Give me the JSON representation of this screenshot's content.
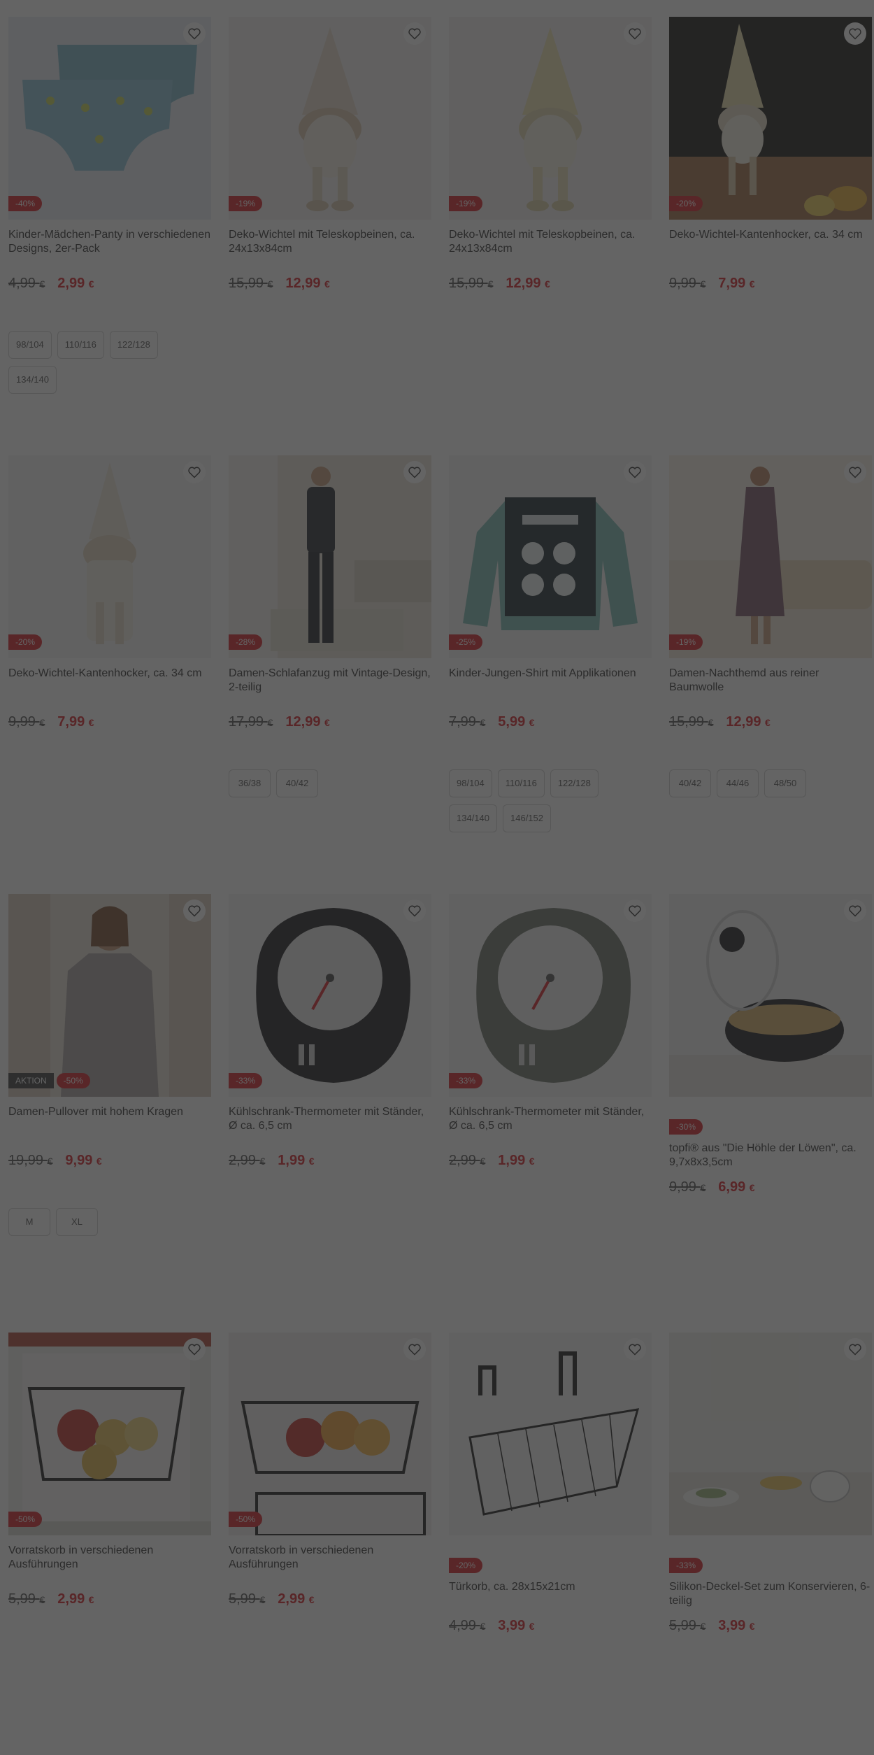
{
  "colors": {
    "sale": "#d8222a",
    "action": "#3d3d3d",
    "overlay": "rgba(40,40,40,0.72)"
  },
  "products": [
    {
      "title": "Kinder-Mädchen-Panty in verschiedenen Designs, 2er-Pack",
      "old_price": "4,99",
      "new_price": "2,99",
      "currency": "€",
      "badge": "-40%",
      "sizes": [
        "98/104",
        "110/116",
        "122/128",
        "134/140"
      ],
      "image": "panties-image"
    },
    {
      "title": "Deko-Wichtel mit Teleskopbeinen, ca. 24x13x84cm",
      "old_price": "15,99",
      "new_price": "12,99",
      "currency": "€",
      "badge": "-19%",
      "sizes": [],
      "image": "gnome-image"
    },
    {
      "title": "Deko-Wichtel mit Teleskopbeinen, ca. 24x13x84cm",
      "old_price": "15,99",
      "new_price": "12,99",
      "currency": "€",
      "badge": "-19%",
      "sizes": [],
      "image": "gnome-image"
    },
    {
      "title": "Deko-Wichtel-Kantenhocker, ca. 34 cm",
      "old_price": "9,99",
      "new_price": "7,99",
      "currency": "€",
      "badge": "-20%",
      "sizes": [],
      "image": "gnome-sitting-image"
    },
    {
      "title": "Deko-Wichtel-Kantenhocker, ca. 34 cm",
      "old_price": "9,99",
      "new_price": "7,99",
      "currency": "€",
      "badge": "-20%",
      "sizes": [],
      "image": "gnome-hanging-image"
    },
    {
      "title": "Damen-Schlafanzug mit Vintage-Design, 2-teilig",
      "old_price": "17,99",
      "new_price": "12,99",
      "currency": "€",
      "badge": "-28%",
      "sizes": [
        "36/38",
        "40/42"
      ],
      "image": "pajama-image"
    },
    {
      "title": "Kinder-Jungen-Shirt mit Applikationen",
      "old_price": "7,99",
      "new_price": "5,99",
      "currency": "€",
      "badge": "-25%",
      "sizes": [
        "98/104",
        "110/116",
        "122/128",
        "134/140",
        "146/152"
      ],
      "image": "shirt-image"
    },
    {
      "title": "Damen-Nachthemd aus reiner Baumwolle",
      "old_price": "15,99",
      "new_price": "12,99",
      "currency": "€",
      "badge": "-19%",
      "sizes": [
        "40/42",
        "44/46",
        "48/50"
      ],
      "image": "nightgown-image"
    },
    {
      "title": "Damen-Pullover mit hohem Kragen",
      "old_price": "19,99",
      "new_price": "9,99",
      "currency": "€",
      "badge": "-50%",
      "action": "AKTION",
      "sizes": [
        "M",
        "XL"
      ],
      "image": "pullover-image"
    },
    {
      "title": "Kühlschrank-Thermometer mit Ständer, Ø ca. 6,5 cm",
      "old_price": "2,99",
      "new_price": "1,99",
      "currency": "€",
      "badge": "-33%",
      "sizes": [],
      "image": "thermometer-black-image"
    },
    {
      "title": "Kühlschrank-Thermometer mit Ständer, Ø ca. 6,5 cm",
      "old_price": "2,99",
      "new_price": "1,99",
      "currency": "€",
      "badge": "-33%",
      "sizes": [],
      "image": "thermometer-grey-image"
    },
    {
      "title": "topfi® aus \"Die Höhle der Löwen\", ca. 9,7x8x3,5cm",
      "old_price": "9,99",
      "new_price": "6,99",
      "currency": "€",
      "badge": "-30%",
      "sizes": [],
      "image": "pot-image"
    },
    {
      "title": "Vorratskorb in verschiedenen Ausführungen",
      "old_price": "5,99",
      "new_price": "2,99",
      "currency": "€",
      "badge": "-50%",
      "sizes": [],
      "image": "basket-fruit-image"
    },
    {
      "title": "Vorratskorb in verschiedenen Ausführungen",
      "old_price": "5,99",
      "new_price": "2,99",
      "currency": "€",
      "badge": "-50%",
      "sizes": [],
      "image": "basket-oranges-image"
    },
    {
      "title": "Türkorb, ca. 28x15x21cm",
      "old_price": "4,99",
      "new_price": "3,99",
      "currency": "€",
      "badge": "-20%",
      "sizes": [],
      "image": "door-basket-image"
    },
    {
      "title": "Silikon-Deckel-Set zum Konservieren, 6-teilig",
      "old_price": "5,99",
      "new_price": "3,99",
      "currency": "€",
      "badge": "-33%",
      "sizes": [],
      "image": "silicone-lids-image"
    }
  ]
}
